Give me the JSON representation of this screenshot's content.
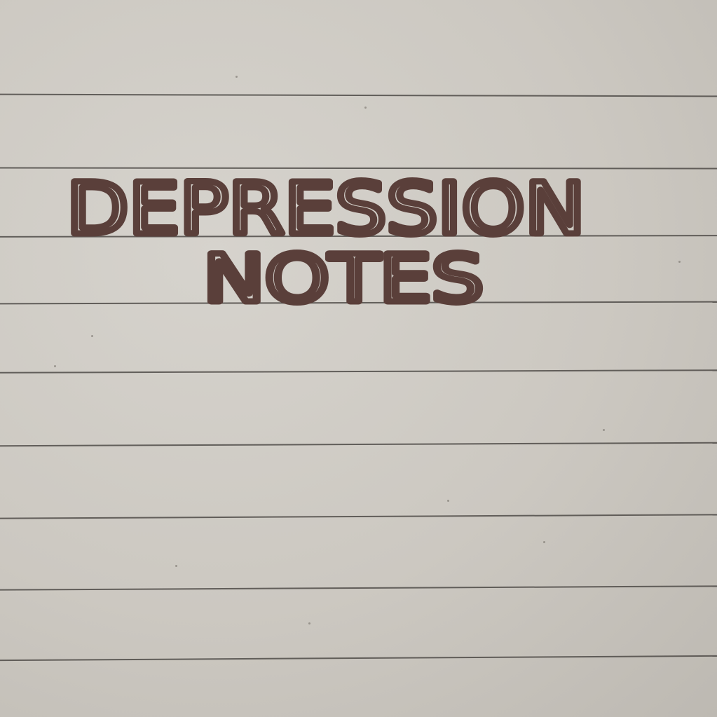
{
  "handwriting": {
    "line1": "DEPRESSION",
    "line2": "NOTES"
  },
  "colors": {
    "paper": "#cfcbc4",
    "rule_line": "#4d4a47",
    "ink": "#5a3f3a"
  }
}
